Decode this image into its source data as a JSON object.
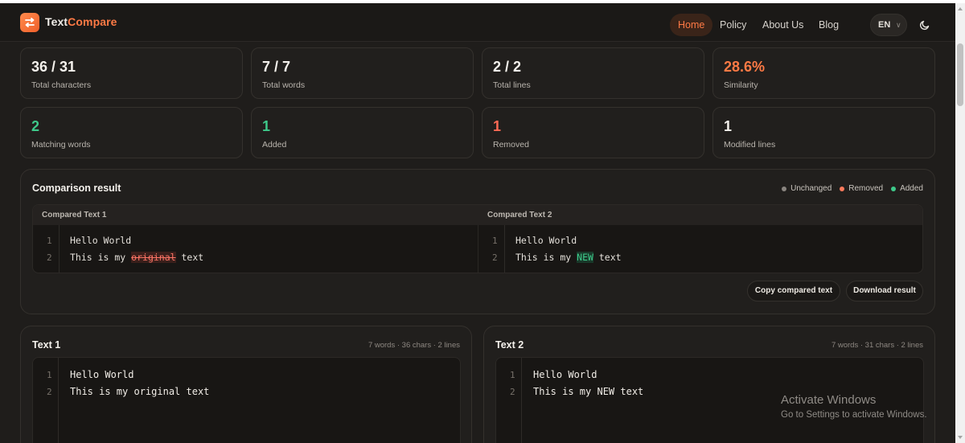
{
  "app": {
    "brand_part1": "Text",
    "brand_part2": "Compare"
  },
  "nav": {
    "items": [
      {
        "label": "Home",
        "active": true
      },
      {
        "label": "Policy"
      },
      {
        "label": "About Us"
      },
      {
        "label": "Blog"
      }
    ],
    "lang": "EN",
    "lang_chevron": "∨"
  },
  "stats": [
    {
      "value": "36 / 31",
      "label": "Total characters"
    },
    {
      "value": "7 / 7",
      "label": "Total words"
    },
    {
      "value": "2 / 2",
      "label": "Total lines"
    },
    {
      "value": "28.6%",
      "label": "Similarity"
    },
    {
      "value": "2",
      "label": "Matching words"
    },
    {
      "value": "1",
      "label": "Added"
    },
    {
      "value": "1",
      "label": "Removed"
    },
    {
      "value": "1",
      "label": "Modified lines"
    }
  ],
  "comparison": {
    "title": "Comparison result",
    "legend": [
      "Unchanged",
      "Removed",
      "Added"
    ],
    "left_header": "Compared Text 1",
    "right_header": "Compared Text 2",
    "line_numbers": [
      "1",
      "2"
    ],
    "left_lines": {
      "l1": "Hello World",
      "l2_prefix": "This is my ",
      "l2_removed": "original",
      "l2_suffix": " text"
    },
    "right_lines": {
      "l1": "Hello World",
      "l2_prefix": "This is my ",
      "l2_added": "NEW",
      "l2_suffix": " text"
    },
    "copy_button": "Copy compared text",
    "download_button": "Download result"
  },
  "text1": {
    "title": "Text 1",
    "meta": "7 words · 36 chars · 2 lines",
    "lines": [
      "Hello World",
      "This is my original text"
    ]
  },
  "text2": {
    "title": "Text 2",
    "meta": "7 words · 31 chars · 2 lines",
    "lines": [
      "Hello World",
      "This is my NEW text"
    ]
  },
  "watermark": {
    "line1": "Activate Windows",
    "line2": "Go to Settings to activate Windows."
  },
  "colors": {
    "accent": "#ff7a45",
    "added": "#3ec98a",
    "removed": "#ff6a55",
    "unchanged": "#8a8580"
  }
}
